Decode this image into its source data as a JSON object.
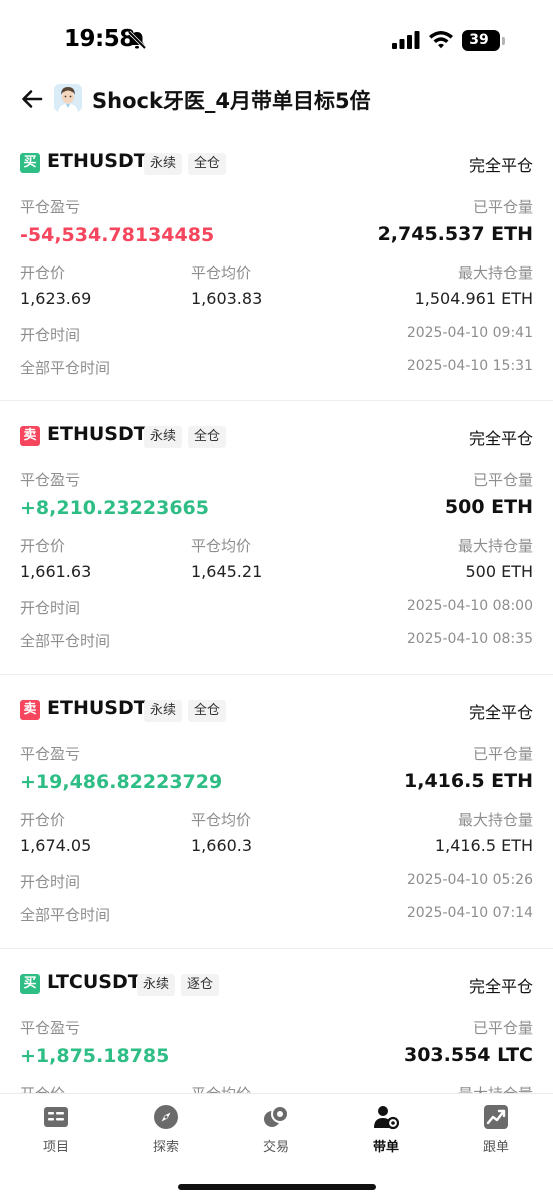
{
  "status_bar": {
    "time": "19:58",
    "battery": "39"
  },
  "header": {
    "title": "Shock牙医_4月带单目标5倍"
  },
  "labels": {
    "pnl": "平仓盈亏",
    "closed_qty": "已平仓量",
    "open_price": "开仓价",
    "avg_close_price": "平仓均价",
    "max_position": "最大持仓量",
    "open_time": "开仓时间",
    "close_time": "全部平仓时间"
  },
  "records": [
    {
      "side": "买",
      "symbol": "ETHUSDT",
      "tag1": "永续",
      "tag2": "全仓",
      "status": "完全平仓",
      "pnl": "-54,534.78134485",
      "closed_qty": "2,745.537 ETH",
      "open_price": "1,623.69",
      "avg_close_price": "1,603.83",
      "max_position": "1,504.961 ETH",
      "open_time": "2025-04-10 09:41",
      "close_time": "2025-04-10 15:31"
    },
    {
      "side": "卖",
      "symbol": "ETHUSDT",
      "tag1": "永续",
      "tag2": "全仓",
      "status": "完全平仓",
      "pnl": "+8,210.23223665",
      "closed_qty": "500 ETH",
      "open_price": "1,661.63",
      "avg_close_price": "1,645.21",
      "max_position": "500 ETH",
      "open_time": "2025-04-10 08:00",
      "close_time": "2025-04-10 08:35"
    },
    {
      "side": "卖",
      "symbol": "ETHUSDT",
      "tag1": "永续",
      "tag2": "全仓",
      "status": "完全平仓",
      "pnl": "+19,486.82223729",
      "closed_qty": "1,416.5 ETH",
      "open_price": "1,674.05",
      "avg_close_price": "1,660.3",
      "max_position": "1,416.5 ETH",
      "open_time": "2025-04-10 05:26",
      "close_time": "2025-04-10 07:14"
    },
    {
      "side": "买",
      "symbol": "LTCUSDT",
      "tag1": "永续",
      "tag2": "逐仓",
      "status": "完全平仓",
      "pnl": "+1,875.18785",
      "closed_qty": "303.554 LTC",
      "open_price": "",
      "avg_close_price": "",
      "max_position": "",
      "open_time": "",
      "close_time": ""
    }
  ],
  "tabs": [
    {
      "label": "项目",
      "icon": "list-icon"
    },
    {
      "label": "探索",
      "icon": "compass-icon"
    },
    {
      "label": "交易",
      "icon": "coins-icon"
    },
    {
      "label": "带单",
      "icon": "leader-icon",
      "active": true
    },
    {
      "label": "跟单",
      "icon": "chart-icon"
    }
  ],
  "colors": {
    "buy": "#2ebd85",
    "sell": "#f6465d"
  }
}
